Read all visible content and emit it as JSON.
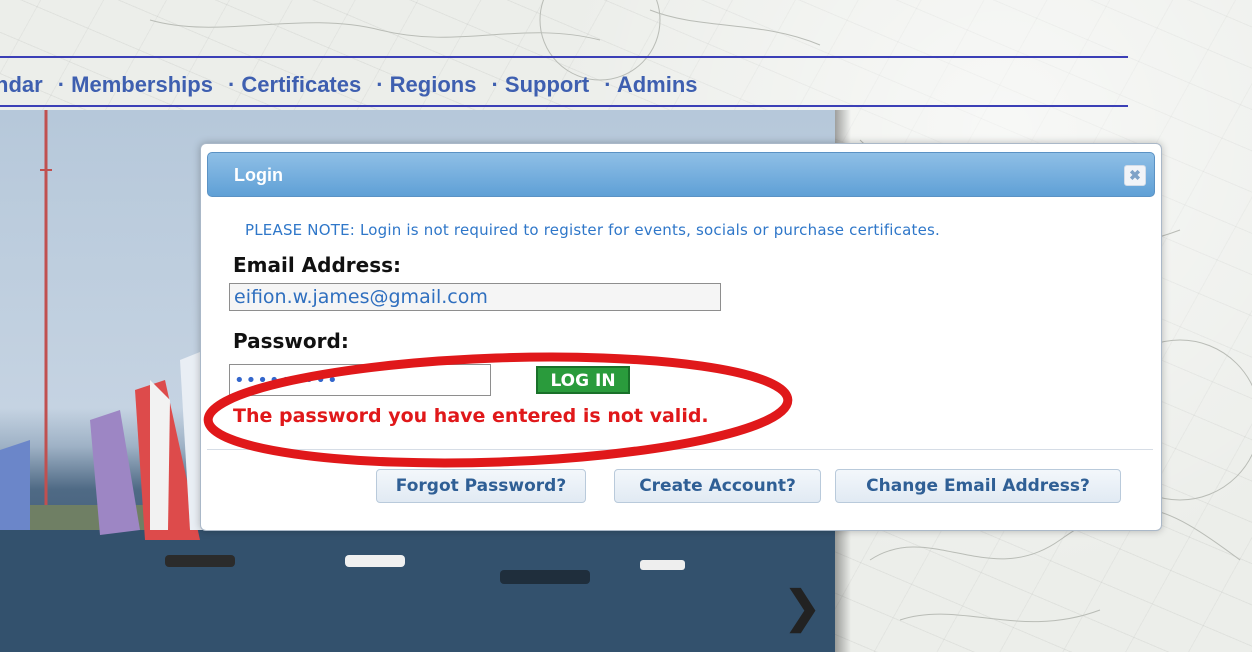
{
  "nav": {
    "items": [
      "ndar",
      "· Memberships",
      "· Certificates",
      "· Regions",
      "· Support",
      "· Admins"
    ]
  },
  "dialog": {
    "title": "Login",
    "close_icon": "close-icon",
    "note": "PLEASE NOTE: Login is not required to register for events, socials or purchase certificates.",
    "email_label": "Email Address:",
    "email_value": "eifion.w.james@gmail.com",
    "password_label": "Password:",
    "password_value": "•••••••••",
    "login_button": "LOG IN",
    "error": "The password you have entered is not valid.",
    "buttons": {
      "forgot": "Forgot Password?",
      "create": "Create Account?",
      "change": "Change Email Address?"
    }
  },
  "carousel": {
    "next_icon": "chevron-right-icon",
    "next_glyph": "❯"
  },
  "colors": {
    "nav_text": "#3e5fb0",
    "nav_rule": "#3b3fb6",
    "header_blue": "#5fa0d6",
    "note_blue": "#2f77c9",
    "login_green": "#2a9b3c",
    "error_red": "#e0181a",
    "annotation_red": "#e0181a"
  }
}
